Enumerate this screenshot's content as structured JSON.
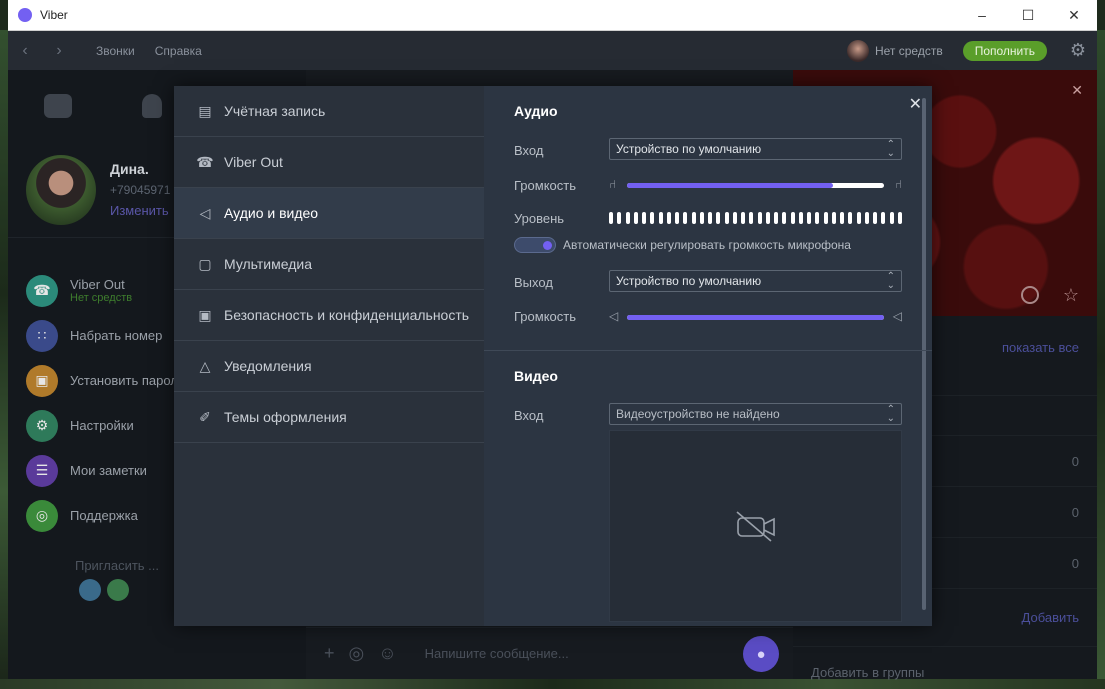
{
  "window": {
    "title": "Viber",
    "controls": [
      "–",
      "☐",
      "✕"
    ]
  },
  "appbar": {
    "menu": [
      "Звонки",
      "Справка"
    ],
    "balance": "Нет средств",
    "topup": "Пополнить"
  },
  "profile": {
    "name": "Дина.",
    "phone": "+79045971",
    "edit": "Изменить"
  },
  "sidebar_items": [
    {
      "label": "Viber Out",
      "sub": "Нет средств",
      "icon": "phone-icon",
      "color": "#2b8a7a"
    },
    {
      "label": "Набрать номер",
      "icon": "dialpad-icon",
      "color": "#3a4a8a"
    },
    {
      "label": "Установить парол",
      "icon": "lock-icon",
      "color": "#b07a2a"
    },
    {
      "label": "Настройки",
      "icon": "gear-icon",
      "color": "#2e7a5a"
    },
    {
      "label": "Мои заметки",
      "icon": "notes-icon",
      "color": "#5a3a9a"
    },
    {
      "label": "Поддержка",
      "icon": "support-icon",
      "color": "#3a8a3a"
    }
  ],
  "invite": "Пригласить ...",
  "composer": {
    "placeholder": "Напишите сообщение..."
  },
  "infopanel": {
    "show_all": "показать все",
    "counts": [
      "0",
      "0",
      "0"
    ],
    "add": "Добавить",
    "add_groups": "Добавить в группы"
  },
  "settings_nav": [
    {
      "label": "Учётная запись",
      "icon": "account-icon"
    },
    {
      "label": "Viber Out",
      "icon": "phone-icon"
    },
    {
      "label": "Аудио и видео",
      "icon": "speaker-icon",
      "active": true
    },
    {
      "label": "Мультимедиа",
      "icon": "media-icon"
    },
    {
      "label": "Безопасность и конфиденциальность",
      "icon": "lock-icon"
    },
    {
      "label": "Уведомления",
      "icon": "bell-icon"
    },
    {
      "label": "Темы оформления",
      "icon": "brush-icon"
    }
  ],
  "audio": {
    "title": "Аудио",
    "input_label": "Вход",
    "input_device": "Устройство по умолчанию",
    "input_volume_label": "Громкость",
    "input_volume": 0.8,
    "level_label": "Уровень",
    "auto_gain_label": "Автоматически регулировать громкость микрофона",
    "auto_gain": true,
    "output_label": "Выход",
    "output_device": "Устройство по умолчанию",
    "output_volume_label": "Громкость",
    "output_volume": 1.0
  },
  "video": {
    "title": "Видео",
    "input_label": "Вход",
    "input_device": "Видеоустройство не найдено"
  },
  "colors": {
    "accent": "#7360f2",
    "topup": "#5a9e2a"
  }
}
